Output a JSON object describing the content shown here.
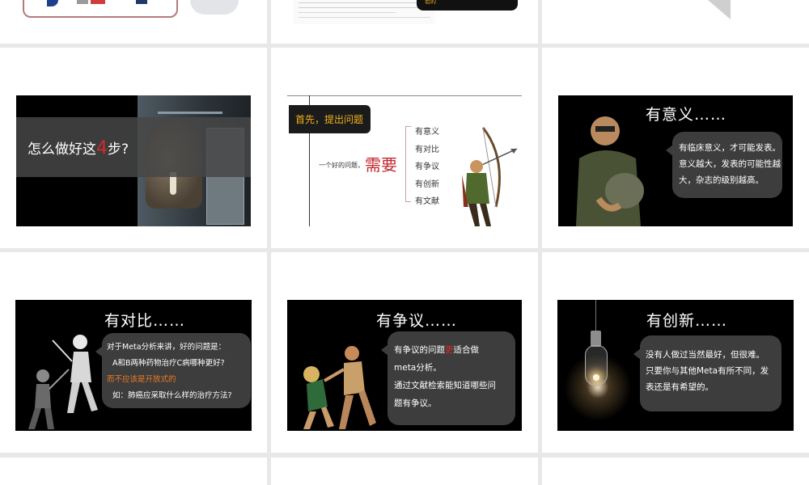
{
  "top_row": {
    "partial_text": "若的"
  },
  "slide_steps": {
    "prefix": "怎么做好这",
    "number": "4",
    "suffix": "步?"
  },
  "slide_question": {
    "badge": "首先，提出问题",
    "intro": "一个好的问题，",
    "keyword": "需要",
    "items": [
      "有意义",
      "有对比",
      "有争议",
      "有创新",
      "有文献"
    ]
  },
  "slide_meaning": {
    "title": "有意义……",
    "lines": [
      "有临床意义，才可能发表。",
      "意义越大，发表的可能性越",
      "大，杂志的级别越高。"
    ]
  },
  "slide_compare": {
    "title": "有对比……",
    "lines": [
      "对于Meta分析来讲，好的问题是：",
      "A和B两种药物治疗C病哪种更好?",
      "而不应该是开放式的",
      "如：肺癌应采取什么样的治疗方法?"
    ]
  },
  "slide_dispute": {
    "title": "有争议……",
    "line1_a": "有争议的问题",
    "line1_b": "更",
    "line1_c": "适合做",
    "line2": "meta分析。",
    "line3": "通过文献检索能知道哪些问",
    "line4": "题有争议。"
  },
  "slide_innovate": {
    "title": "有创新……",
    "lines": [
      "没有人做过当然最好，但很难。",
      "只要你与其他Meta有所不同，发",
      "表还是有希望的。"
    ]
  },
  "colors": {
    "accent_red": "#d42a2a",
    "badge_gold": "#f2b21a",
    "orange_text": "#f07a20",
    "bubble_bg": "#3d3d3d"
  }
}
